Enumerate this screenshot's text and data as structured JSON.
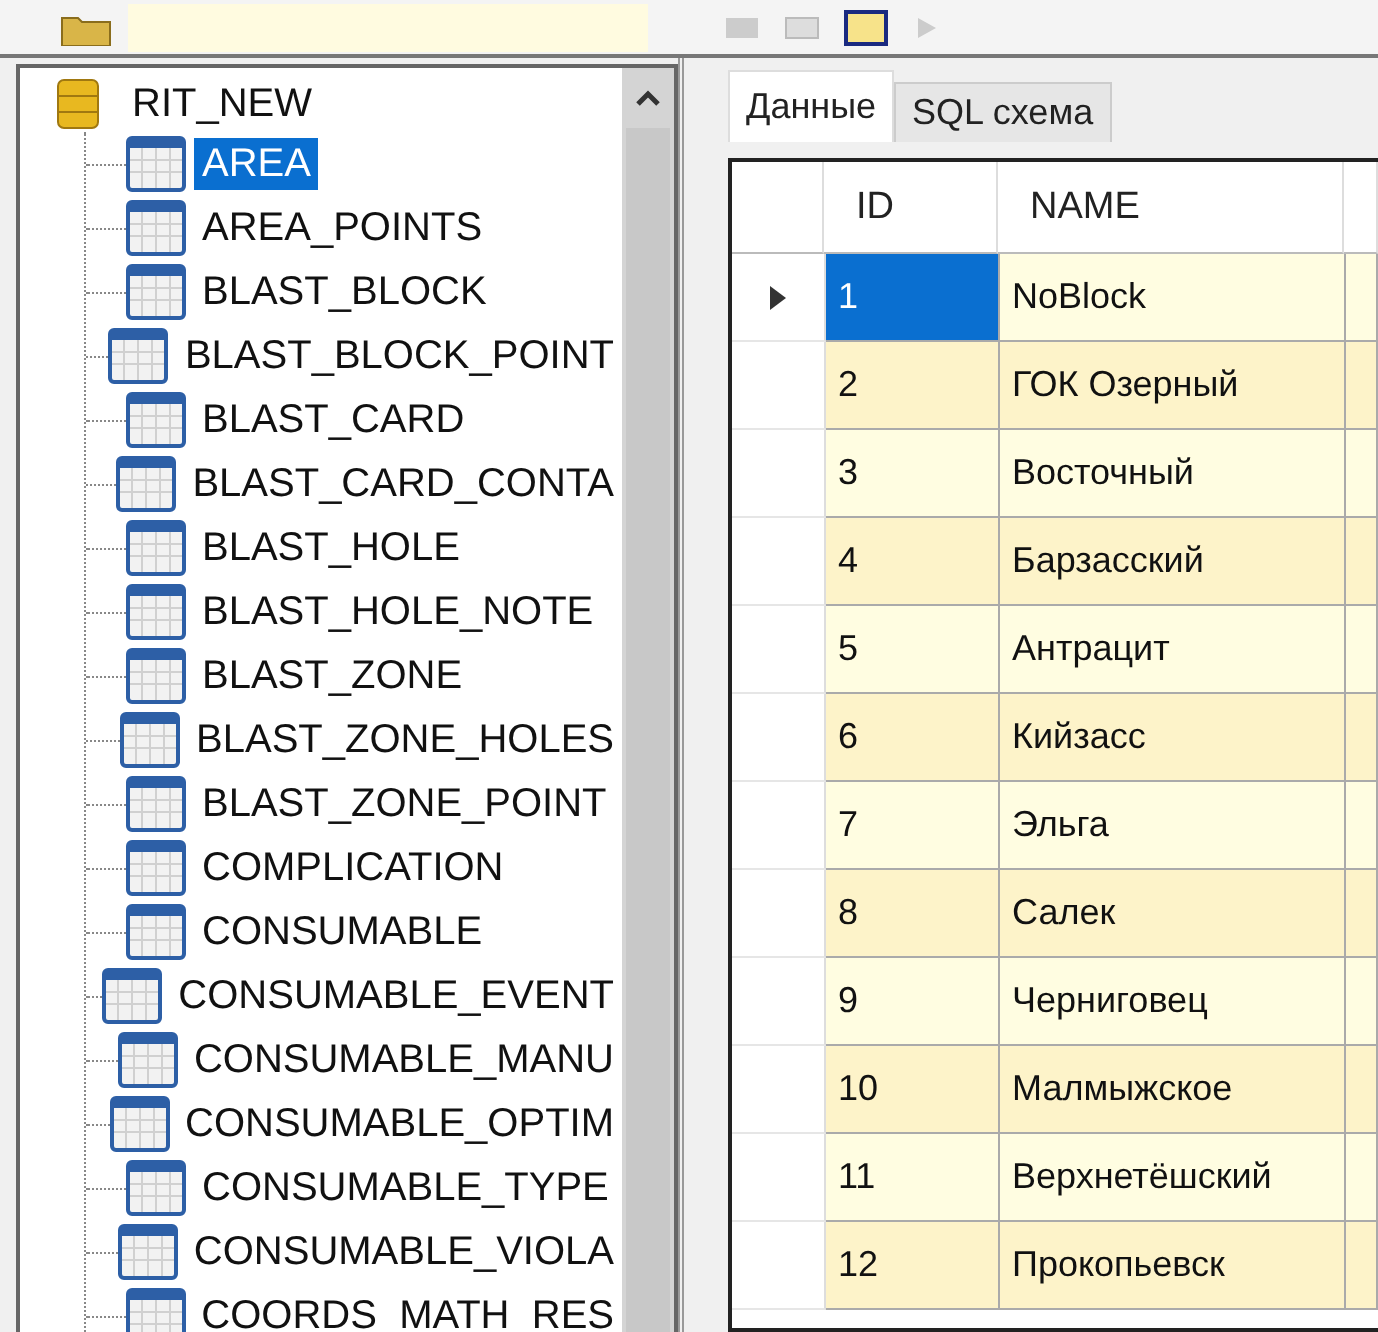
{
  "tree": {
    "root": {
      "label": "RIT_NEW"
    },
    "children": [
      {
        "label": "AREA",
        "selected": true
      },
      {
        "label": "AREA_POINTS",
        "selected": false
      },
      {
        "label": "BLAST_BLOCK",
        "selected": false
      },
      {
        "label": "BLAST_BLOCK_POINT",
        "selected": false
      },
      {
        "label": "BLAST_CARD",
        "selected": false
      },
      {
        "label": "BLAST_CARD_CONTA",
        "selected": false
      },
      {
        "label": "BLAST_HOLE",
        "selected": false
      },
      {
        "label": "BLAST_HOLE_NOTE",
        "selected": false
      },
      {
        "label": "BLAST_ZONE",
        "selected": false
      },
      {
        "label": "BLAST_ZONE_HOLES",
        "selected": false
      },
      {
        "label": "BLAST_ZONE_POINT",
        "selected": false
      },
      {
        "label": "COMPLICATION",
        "selected": false
      },
      {
        "label": "CONSUMABLE",
        "selected": false
      },
      {
        "label": "CONSUMABLE_EVENT",
        "selected": false
      },
      {
        "label": "CONSUMABLE_MANU",
        "selected": false
      },
      {
        "label": "CONSUMABLE_OPTIM",
        "selected": false
      },
      {
        "label": "CONSUMABLE_TYPE",
        "selected": false
      },
      {
        "label": "CONSUMABLE_VIOLA",
        "selected": false
      },
      {
        "label": "COORDS_MATH_RES",
        "selected": false
      }
    ]
  },
  "tabs": [
    {
      "label": "Данные",
      "selected": true
    },
    {
      "label": "SQL схема",
      "selected": false
    }
  ],
  "table": {
    "columns": [
      "ID",
      "NAME"
    ],
    "rows": [
      {
        "id": "1",
        "name": "NoBlock",
        "selected": true
      },
      {
        "id": "2",
        "name": "ГОК Озерный",
        "selected": false
      },
      {
        "id": "3",
        "name": "Восточный",
        "selected": false
      },
      {
        "id": "4",
        "name": "Барзасский",
        "selected": false
      },
      {
        "id": "5",
        "name": "Антрацит",
        "selected": false
      },
      {
        "id": "6",
        "name": "Кийзасс",
        "selected": false
      },
      {
        "id": "7",
        "name": "Эльга",
        "selected": false
      },
      {
        "id": "8",
        "name": "Салек",
        "selected": false
      },
      {
        "id": "9",
        "name": "Черниговец",
        "selected": false
      },
      {
        "id": "10",
        "name": "Малмыжское",
        "selected": false
      },
      {
        "id": "11",
        "name": "Верхнетёшский",
        "selected": false
      },
      {
        "id": "12",
        "name": "Прокопьевск",
        "selected": false
      }
    ]
  }
}
